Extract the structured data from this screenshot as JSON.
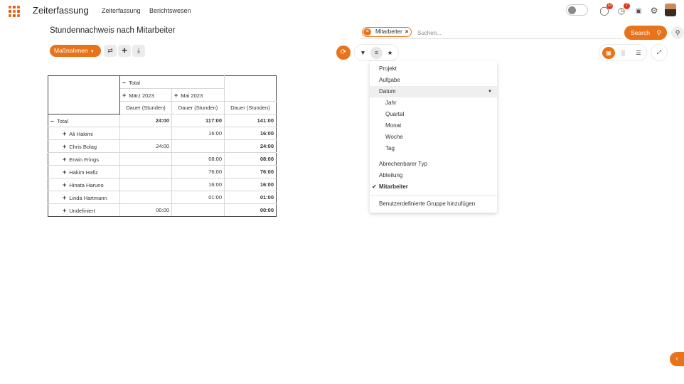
{
  "app": {
    "title": "Zeiterfassung",
    "menu": [
      "Zeiterfassung",
      "Berichtswesen"
    ]
  },
  "systray": {
    "messages_count": "10",
    "activities_count": "7"
  },
  "control_panel": {
    "page_title": "Stundennachweis nach Mitarbeiter",
    "actions_label": "Maßnahmen"
  },
  "search": {
    "facet_label": "Mitarbeiter",
    "placeholder": "Suchen...",
    "button_label": "Search"
  },
  "groupby_menu": {
    "items": [
      {
        "label": "Projekt"
      },
      {
        "label": "Aufgabe"
      },
      {
        "label": "Datum"
      },
      {
        "label": "Jahr"
      },
      {
        "label": "Quartal"
      },
      {
        "label": "Monat"
      },
      {
        "label": "Woche"
      },
      {
        "label": "Tag"
      },
      {
        "label": "Abrechenbarer Typ"
      },
      {
        "label": "Abteilung"
      },
      {
        "label": "Mitarbeiter"
      },
      {
        "label": "Benutzerdefinierte Gruppe hinzufügen"
      }
    ]
  },
  "pivot": {
    "col_total_label": "Total",
    "col_groups": [
      "März 2023",
      "Mai 2023"
    ],
    "measure_label": "Dauer (Stunden)",
    "total_row": {
      "label": "Total",
      "values": [
        "24:00",
        "117:00",
        "141:00"
      ]
    },
    "rows": [
      {
        "label": "Ali Hakimi",
        "values": [
          "",
          "16:00",
          "16:00"
        ]
      },
      {
        "label": "Chris Bolag",
        "values": [
          "24:00",
          "",
          "24:00"
        ]
      },
      {
        "label": "Erwin Frings",
        "values": [
          "",
          "08:00",
          "08:00"
        ]
      },
      {
        "label": "Hakim Hafiz",
        "values": [
          "",
          "76:00",
          "76:00"
        ]
      },
      {
        "label": "Hinata Haruno",
        "values": [
          "",
          "16:00",
          "16:00"
        ]
      },
      {
        "label": "Linda Hartmann",
        "values": [
          "",
          "01:00",
          "01:00"
        ]
      },
      {
        "label": "Undefiniert",
        "values": [
          "00:00",
          "",
          "00:00"
        ]
      }
    ]
  },
  "colors": {
    "accent": "#e8731b",
    "badge": "#e0351b"
  }
}
